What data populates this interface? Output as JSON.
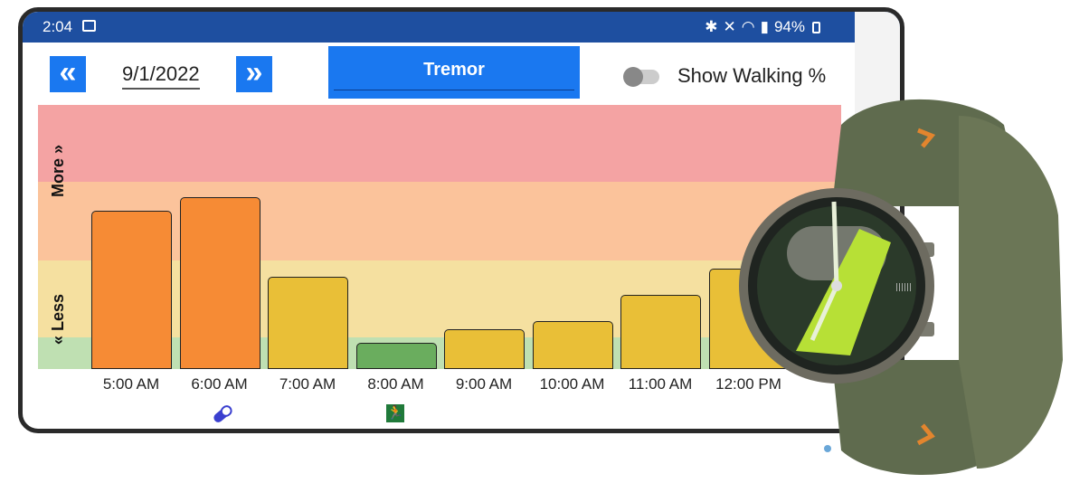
{
  "status": {
    "time": "2:04",
    "battery_text": "94%"
  },
  "nav": {
    "prev_icon": "double-chevron-left",
    "next_icon": "double-chevron-right",
    "date": "9/1/2022"
  },
  "metric": {
    "label": "Tremor"
  },
  "toggle": {
    "label": "Show Walking %",
    "on": false
  },
  "axis": {
    "more_label": "More",
    "less_label": "Less"
  },
  "colors": {
    "accent": "#1a78f0",
    "orange": "#f68b35",
    "yellow": "#e9bf37",
    "green": "#6aad5e",
    "band_red": "#f4a3a3",
    "band_orange": "#fbc39b",
    "band_yellow": "#f5e0a0",
    "band_green": "#bfe0b2"
  },
  "chart_data": {
    "type": "bar",
    "categories": [
      "5:00 AM",
      "6:00 AM",
      "7:00 AM",
      "8:00 AM",
      "9:00 AM",
      "10:00 AM",
      "11:00 AM",
      "12:00 PM"
    ],
    "values": [
      0.6,
      0.65,
      0.35,
      0.1,
      0.15,
      0.18,
      0.28,
      0.38
    ],
    "bar_colors": [
      "orange",
      "orange",
      "yellow",
      "green",
      "yellow",
      "yellow",
      "yellow",
      "yellow"
    ],
    "ylim": [
      0,
      1
    ],
    "bands": [
      {
        "name": "green",
        "from": 0,
        "to": 0.12
      },
      {
        "name": "yellow",
        "from": 0.12,
        "to": 0.41
      },
      {
        "name": "orange",
        "from": 0.41,
        "to": 0.71
      },
      {
        "name": "red",
        "from": 0.71,
        "to": 1
      }
    ],
    "event_icons": [
      {
        "category": "6:00 AM",
        "icon": "pill-icon"
      },
      {
        "category": "8:00 AM",
        "icon": "running-exit-icon"
      }
    ]
  }
}
